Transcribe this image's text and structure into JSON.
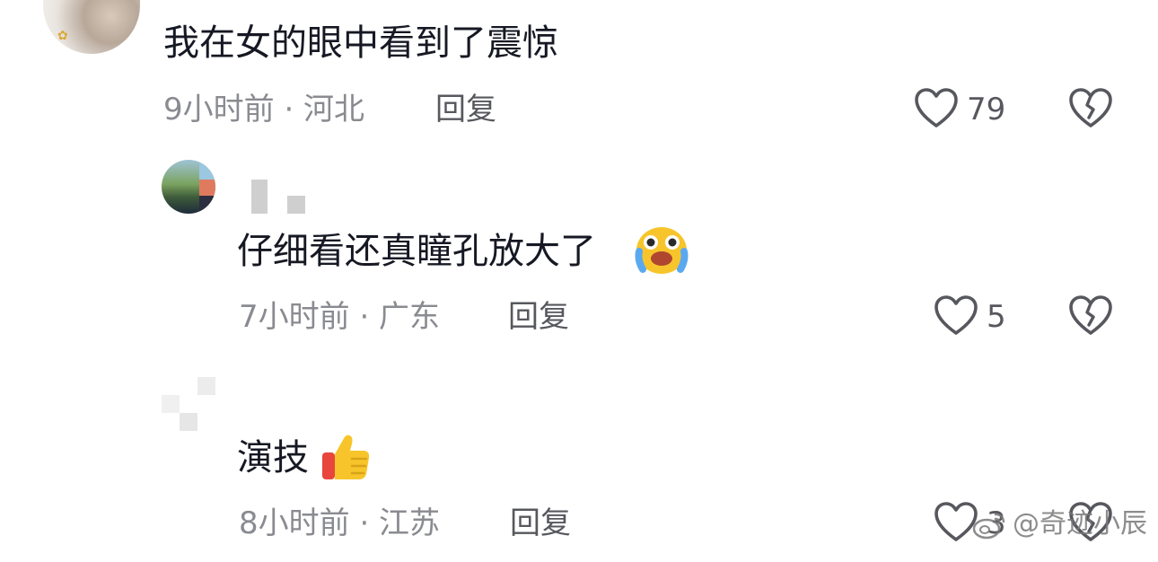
{
  "comments": [
    {
      "text": "我在女的眼中看到了震惊",
      "time_location": "9小时前 · 河北",
      "reply_label": "回复",
      "like_count": "79"
    },
    {
      "text": "仔细看还真瞳孔放大了",
      "emoji": "😭",
      "time_location": "7小时前 · 广东",
      "reply_label": "回复",
      "like_count": "5"
    },
    {
      "text": "演技",
      "emoji": "👍",
      "time_location": "8小时前 · 江苏",
      "reply_label": "回复",
      "like_count": "3"
    }
  ],
  "icons": {
    "like": "heart-outline-icon",
    "dislike": "broken-heart-icon"
  },
  "colors": {
    "text": "#161823",
    "meta": "#8a8b91",
    "action": "#57585e"
  },
  "watermark": {
    "handle": "@奇迹小辰"
  }
}
